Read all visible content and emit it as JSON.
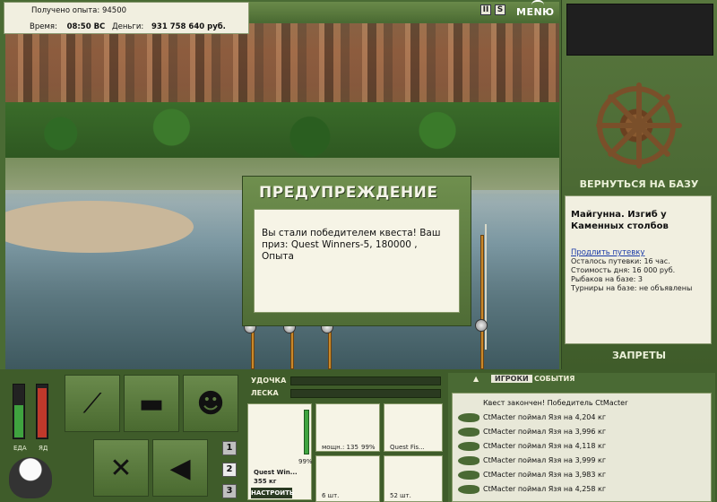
{
  "info": {
    "experience_label": "Получено опыта:",
    "experience_value": "94500",
    "time_label": "Время:",
    "time_value": "08:50 ВС",
    "money_label": "Деньги:",
    "money_value": "931 758 640 руб."
  },
  "topbar": {
    "pause_icon": "II",
    "sound_icon": "S",
    "menu_label": "MENЮ"
  },
  "right": {
    "return_label": "ВЕРНУТЬСЯ НА БАЗУ",
    "location_title": "Майгунна. Изгиб у Каменных столбов",
    "extend_link": "Продлить путевку",
    "remaining": "Осталось путевки: 16 час.",
    "cost": "Стоимость дня: 16 000 руб.",
    "fishers": "Рыбаков на базе: 3",
    "tournaments": "Турниры на базе: не объявлены",
    "bans_label": "ЗАПРЕТЫ"
  },
  "dialog": {
    "title": "ПРЕДУПРЕЖДЕНИЕ",
    "message": "Вы стали победителем квеста! Ваш приз: Quest Winners-5, 180000 , Опыта"
  },
  "bars": {
    "food_label": "ЕДА",
    "poison_label": "ЯД",
    "food_level": 0.62,
    "poison_level": 0.95
  },
  "pages": [
    "1",
    "2",
    "3"
  ],
  "tackle": {
    "rod_label": "УДОЧКА",
    "line_label": "ЛЕСКА",
    "rod_name": "Quest Win...",
    "rod_weight": "355 кг",
    "rod_percent": "99%",
    "reel_text": "мощн.: 135",
    "reel_percent": "99%",
    "line_item": "Quest Fis...",
    "hook_text": "6 шт.",
    "bait_text": "52 шт.",
    "setup_button": "НАСТРОИТЬ"
  },
  "chat": {
    "tab_players": "ИГРОКИ",
    "tab_events": "СОБЫТИЯ",
    "lines": [
      "Квест закончен! Победитель CtMacter",
      "CtMacter поймал Язя на 4,204 кг",
      "CtMacter поймал Язя на 3,996 кг",
      "CtMacter поймал Язя на 4,118 кг",
      "CtMacter поймал Язя на 3,999 кг",
      "CtMacter поймал Язя на 3,983 кг",
      "CtMacter поймал Язя на 4,258 кг"
    ]
  }
}
